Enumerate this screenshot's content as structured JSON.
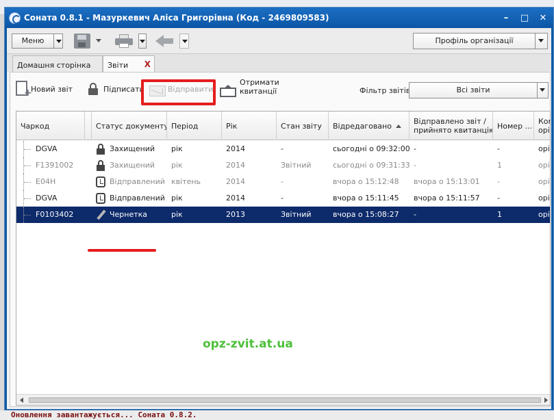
{
  "window": {
    "title": "Соната 0.8.1 - Мазуркевич Аліса Григорівна (Код - 2469809583)",
    "minimize_glyph": "–",
    "maximize_glyph": "□",
    "close_glyph": "✕"
  },
  "toolbar": {
    "menu_label": "Меню",
    "profile_label": "Профіль організації"
  },
  "tabs": [
    {
      "label": "Домашня сторінка",
      "active": false
    },
    {
      "label": "Звіти",
      "active": true,
      "close_glyph": "X"
    }
  ],
  "actions": {
    "new_report": "Новий звіт",
    "sign": "Підписати",
    "send": "Відправити",
    "receive_line1": "Отримати",
    "receive_line2": "квитанції",
    "filter_label": "Фільтр звітів:",
    "filter_value": "Всі звіти"
  },
  "table": {
    "columns": [
      "Чаркод",
      "Статус документу",
      "Період",
      "Рік",
      "Стан звіту",
      "Відредаговано",
      "Відправлено звіт /",
      "прийнято квитанцію",
      "Номер ...",
      "Ком",
      "орі"
    ],
    "rows": [
      {
        "code": "DGVA",
        "status": "Захищений",
        "status_icon": "lock-icon",
        "period": "рік",
        "year": "2014",
        "state": "-",
        "edited": "сьогодні о 09:32:00",
        "sent": "-",
        "number": "-",
        "comment": "орі",
        "dim": false,
        "selected": false
      },
      {
        "code": "F1391002",
        "status": "Захищений",
        "status_icon": "lock-icon",
        "period": "рік",
        "year": "2014",
        "state": "Звітний",
        "edited": "сьогодні о 09:31:33",
        "sent": "-",
        "number": "1",
        "comment": "орі",
        "dim": true,
        "selected": false
      },
      {
        "code": "E04H",
        "status": "Відправлений",
        "status_icon": "clock-icon",
        "period": "квітень",
        "year": "2014",
        "state": "-",
        "edited": "вчора о 15:12:48",
        "sent": "вчора о 15:13:01",
        "number": "-",
        "comment": "орі",
        "dim": true,
        "selected": false
      },
      {
        "code": "DGVA",
        "status": "Відправлений",
        "status_icon": "clock-icon",
        "period": "рік",
        "year": "2014",
        "state": "-",
        "edited": "вчора о 15:11:45",
        "sent": "вчора о 15:11:57",
        "number": "-",
        "comment": "орі",
        "dim": false,
        "selected": false
      },
      {
        "code": "F0103402",
        "status": "Чернетка",
        "status_icon": "pencil-icon",
        "period": "рік",
        "year": "2013",
        "state": "Звітний",
        "edited": "вчора о 15:08:27",
        "sent": "-",
        "number": "1",
        "comment": "орі",
        "dim": false,
        "selected": true
      }
    ]
  },
  "watermark": "opz-zvit.at.ua",
  "statusbar": "Оновлення завантажується... Соната 0.8.2.",
  "colors": {
    "title_bar": "#0b56a5",
    "selected_row": "#0d2a6a",
    "highlight": "#e51c1c",
    "watermark": "#4dc03a"
  }
}
